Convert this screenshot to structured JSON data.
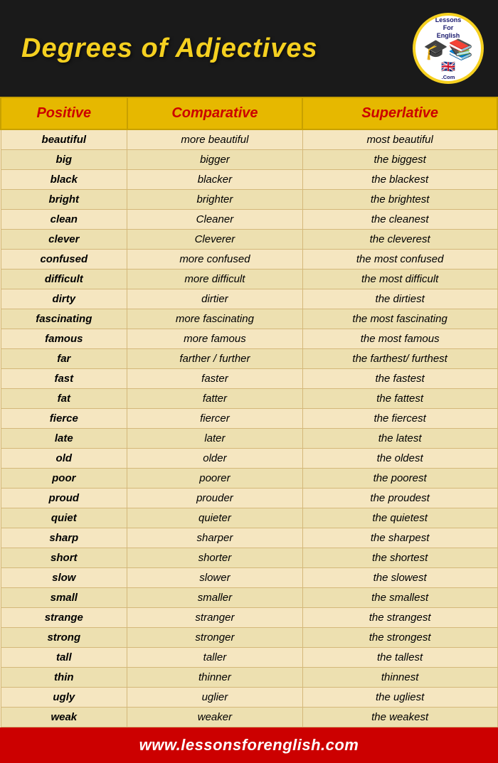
{
  "header": {
    "title": "Degrees of Adjectives"
  },
  "logo": {
    "top_text": "LessonsForEnglish",
    "bottom_text": ".Com"
  },
  "table": {
    "headers": [
      "Positive",
      "Comparative",
      "Superlative"
    ],
    "rows": [
      [
        "beautiful",
        "more beautiful",
        "most beautiful"
      ],
      [
        "big",
        "bigger",
        "the biggest"
      ],
      [
        "black",
        "blacker",
        "the blackest"
      ],
      [
        "bright",
        "brighter",
        "the brightest"
      ],
      [
        "clean",
        "Cleaner",
        "the cleanest"
      ],
      [
        "clever",
        "Cleverer",
        "the cleverest"
      ],
      [
        "confused",
        "more confused",
        "the most confused"
      ],
      [
        "difficult",
        "more difficult",
        "the most difficult"
      ],
      [
        "dirty",
        "dirtier",
        "the dirtiest"
      ],
      [
        "fascinating",
        "more fascinating",
        "the most fascinating"
      ],
      [
        "famous",
        "more famous",
        "the most famous"
      ],
      [
        "far",
        "farther / further",
        "the farthest/ furthest"
      ],
      [
        "fast",
        "faster",
        "the fastest"
      ],
      [
        "fat",
        "fatter",
        "the fattest"
      ],
      [
        "fierce",
        "fiercer",
        "the fiercest"
      ],
      [
        "late",
        "later",
        "the latest"
      ],
      [
        "old",
        "older",
        "the oldest"
      ],
      [
        "poor",
        "poorer",
        "the poorest"
      ],
      [
        "proud",
        "prouder",
        "the proudest"
      ],
      [
        "quiet",
        "quieter",
        "the quietest"
      ],
      [
        "sharp",
        "sharper",
        "the sharpest"
      ],
      [
        "short",
        "shorter",
        "the shortest"
      ],
      [
        "slow",
        "slower",
        "the slowest"
      ],
      [
        "small",
        "smaller",
        "the smallest"
      ],
      [
        "strange",
        "stranger",
        "the strangest"
      ],
      [
        "strong",
        "stronger",
        "the strongest"
      ],
      [
        "tall",
        "taller",
        "the tallest"
      ],
      [
        "thin",
        "thinner",
        "thinnest"
      ],
      [
        "ugly",
        "uglier",
        "the ugliest"
      ],
      [
        "weak",
        "weaker",
        "the weakest"
      ]
    ]
  },
  "footer": {
    "url": "www.lessonsforenglish.com"
  }
}
